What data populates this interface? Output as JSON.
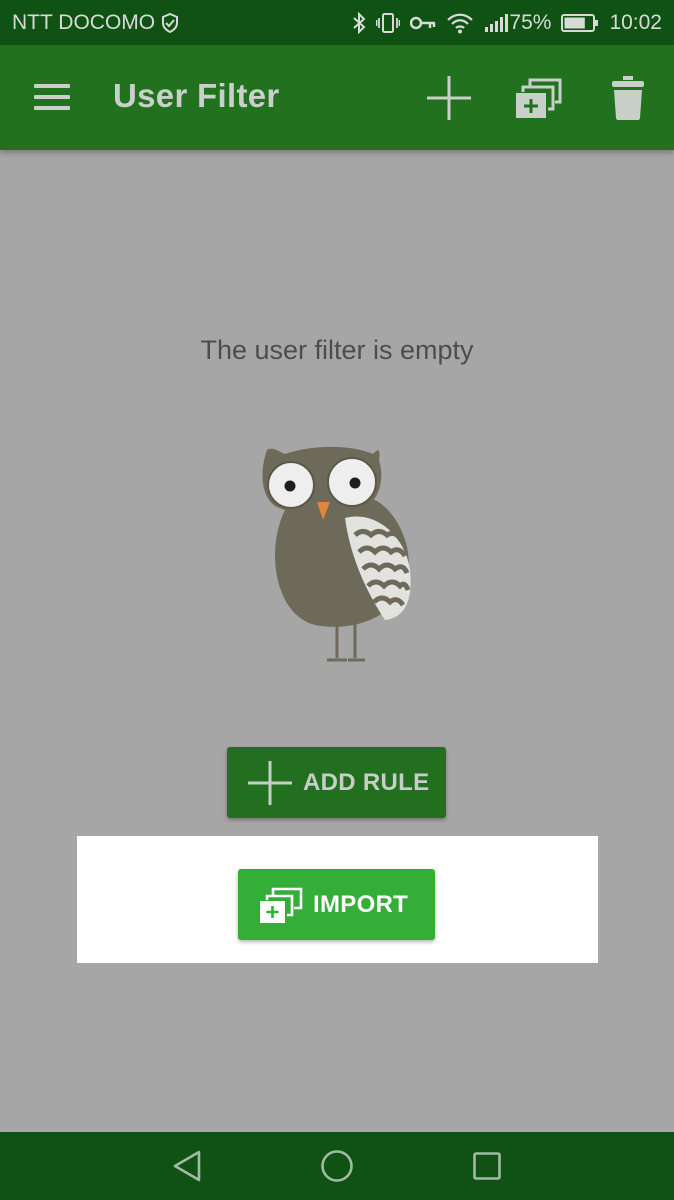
{
  "status_bar": {
    "carrier": "NTT DOCOMO",
    "battery_percent": "75%",
    "battery_level": 0.75,
    "time": "10:02",
    "icons": [
      "shield-icon",
      "bluetooth-icon",
      "vibrate-icon",
      "vpn-key-icon",
      "wifi-icon",
      "signal-icon",
      "battery-icon"
    ]
  },
  "app_bar": {
    "title": "User Filter",
    "actions": [
      "add-icon",
      "import-icon",
      "delete-icon"
    ],
    "menu_icon": "hamburger-menu-icon"
  },
  "content": {
    "empty_message": "The user filter is empty",
    "illustration": "owl-illustration",
    "add_rule_label": "ADD RULE",
    "import_label": "IMPORT"
  },
  "nav_bar": {
    "buttons": [
      "back-icon",
      "home-icon",
      "recents-icon"
    ]
  },
  "colors": {
    "status_bar": "#0f5213",
    "app_bar": "#21711f",
    "background": "#a6a6a6",
    "import_button": "#34ae36",
    "add_rule_button": "#216f1f"
  }
}
